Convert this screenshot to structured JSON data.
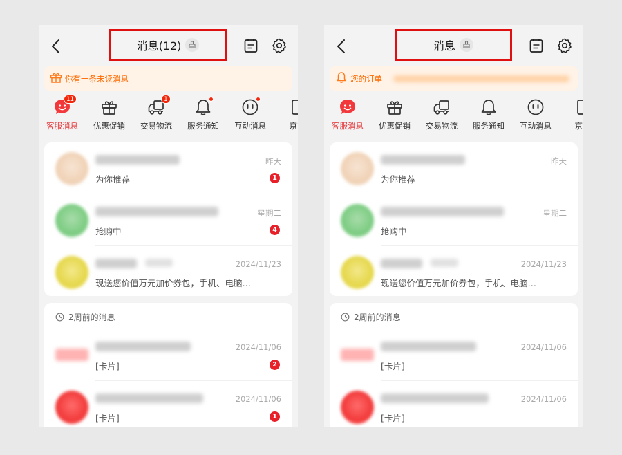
{
  "screens": [
    {
      "title": "消息(12)",
      "banner_text": "你有一条未读消息",
      "banner_icon": "gift-icon",
      "categories": [
        {
          "label": "客服消息",
          "icon": "smile-chat-icon",
          "badge": "11",
          "active": true
        },
        {
          "label": "优惠促销",
          "icon": "gift-box-icon",
          "badge": "",
          "active": false
        },
        {
          "label": "交易物流",
          "icon": "truck-icon",
          "badge": "1",
          "active": false
        },
        {
          "label": "服务通知",
          "icon": "bell-icon",
          "badge": "dot",
          "active": false
        },
        {
          "label": "互动消息",
          "icon": "face-icon",
          "badge": "dot",
          "active": false
        },
        {
          "label": "京东",
          "icon": "doc-icon",
          "badge": "",
          "active": false
        }
      ],
      "messages": [
        {
          "time": "昨天",
          "preview": "为你推荐",
          "count": "1"
        },
        {
          "time": "星期二",
          "preview": "抢购中",
          "count": "4"
        },
        {
          "time": "2024/11/23",
          "preview": "现送您价值万元加价券包，手机、电脑…",
          "count": ""
        }
      ],
      "section_label": "2周前的消息",
      "older_messages": [
        {
          "time": "2024/11/06",
          "preview": "[卡片]",
          "count": "2"
        },
        {
          "time": "2024/11/06",
          "preview": "[卡片]",
          "count": "1"
        }
      ]
    },
    {
      "title": "消息",
      "banner_text": "您的订单",
      "banner_icon": "bell-icon",
      "categories": [
        {
          "label": "客服消息",
          "icon": "smile-chat-icon",
          "badge": "",
          "active": true
        },
        {
          "label": "优惠促销",
          "icon": "gift-box-icon",
          "badge": "",
          "active": false
        },
        {
          "label": "交易物流",
          "icon": "truck-icon",
          "badge": "",
          "active": false
        },
        {
          "label": "服务通知",
          "icon": "bell-icon",
          "badge": "",
          "active": false
        },
        {
          "label": "互动消息",
          "icon": "face-icon",
          "badge": "",
          "active": false
        },
        {
          "label": "京东",
          "icon": "doc-icon",
          "badge": "",
          "active": false
        }
      ],
      "messages": [
        {
          "time": "昨天",
          "preview": "为你推荐",
          "count": ""
        },
        {
          "time": "星期二",
          "preview": "抢购中",
          "count": ""
        },
        {
          "time": "2024/11/23",
          "preview": "现送您价值万元加价券包，手机、电脑…",
          "count": ""
        }
      ],
      "section_label": "2周前的消息",
      "older_messages": [
        {
          "time": "2024/11/06",
          "preview": "[卡片]",
          "count": ""
        },
        {
          "time": "2024/11/06",
          "preview": "[卡片]",
          "count": ""
        }
      ]
    }
  ],
  "colors": {
    "accent": "#e4393c",
    "highlight_box": "#e01010",
    "banner_bg": "#fff2e6",
    "banner_text": "#ff6a00"
  }
}
